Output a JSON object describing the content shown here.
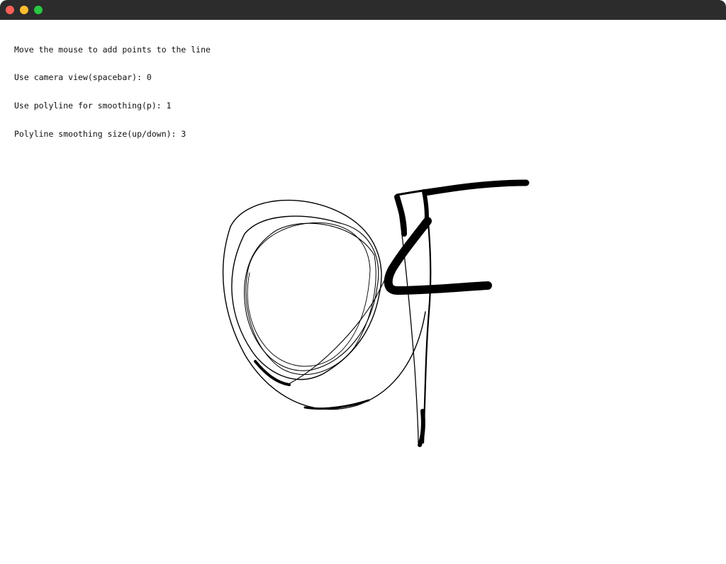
{
  "window": {
    "traffic_colors": {
      "close": "#ff5f57",
      "minimize": "#febc2e",
      "maximize": "#28c840"
    },
    "titlebar_color": "#2c2c2c"
  },
  "info": {
    "line1": "Move the mouse to add points to the line",
    "line2": "Use camera view(spacebar): 0",
    "line3": "Use polyline for smoothing(p): 1",
    "line4": "Polyline smoothing size(up/down): 3"
  },
  "drawing": {
    "description_color": "#000000"
  }
}
